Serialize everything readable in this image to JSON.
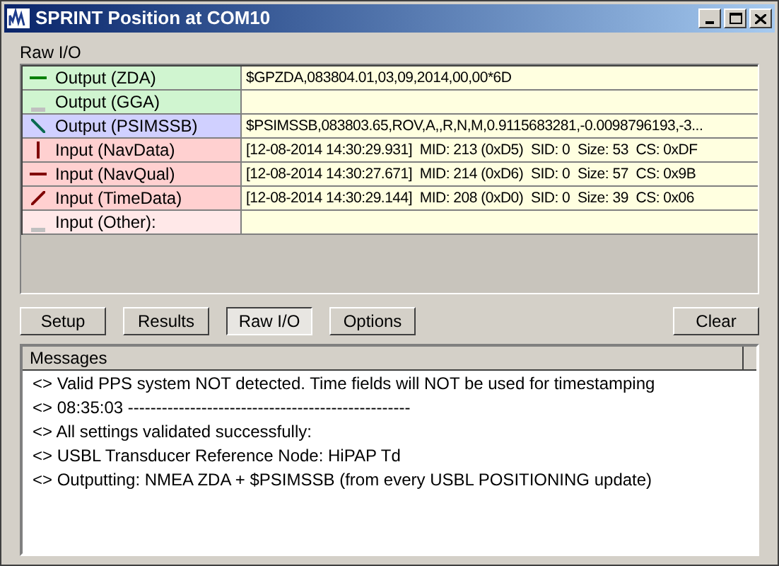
{
  "window": {
    "title": "SPRINT Position at COM10"
  },
  "section_label": "Raw I/O",
  "io_rows": [
    {
      "label": "Output (ZDA)",
      "value": "$GPZDA,083804.01,03,09,2014,00,00*6D",
      "color": "#d0f5d0",
      "kind": "horizontal"
    },
    {
      "label": "Output (GGA)",
      "value": "",
      "color": "#d0f5d0",
      "kind": "idle"
    },
    {
      "label": "Output (PSIMSSB)",
      "value": "$PSIMSSB,083803.65,ROV,A,,R,N,M,0.9115683281,-0.0098796193,-3...",
      "color": "#d0d0ff",
      "kind": "diagonal"
    },
    {
      "label": "Input (NavData)",
      "value": "[12-08-2014 14:30:29.931]  MID: 213 (0xD5)  SID: 0  Size: 53  CS: 0xDF",
      "color": "#ffd0d0",
      "kind": "vertical"
    },
    {
      "label": "Input (NavQual)",
      "value": "[12-08-2014 14:30:27.671]  MID: 214 (0xD6)  SID: 0  Size: 57  CS: 0x9B",
      "color": "#ffd0d0",
      "kind": "horizontal"
    },
    {
      "label": "Input (TimeData)",
      "value": "[12-08-2014 14:30:29.144]  MID: 208 (0xD0)  SID: 0  Size: 39  CS: 0x06",
      "color": "#ffd0d0",
      "kind": "slash"
    },
    {
      "label": "Input (Other):",
      "value": "",
      "color": "#ffe8e8",
      "kind": "idle"
    }
  ],
  "buttons": [
    {
      "label": "Setup",
      "selected": false
    },
    {
      "label": "Results",
      "selected": false
    },
    {
      "label": "Raw I/O",
      "selected": true
    },
    {
      "label": "Options",
      "selected": false
    }
  ],
  "clear_button": "Clear",
  "messages": {
    "header": "Messages",
    "lines": [
      "<> Valid PPS system NOT detected. Time fields will NOT be used for timestamping",
      "<> 08:35:03 --------------------------------------------------",
      "<> All settings validated successfully:",
      "<> USBL Transducer Reference Node: HiPAP Td",
      "<> Outputting: NMEA ZDA + $PSIMSSB (from every USBL POSITIONING update)"
    ]
  }
}
